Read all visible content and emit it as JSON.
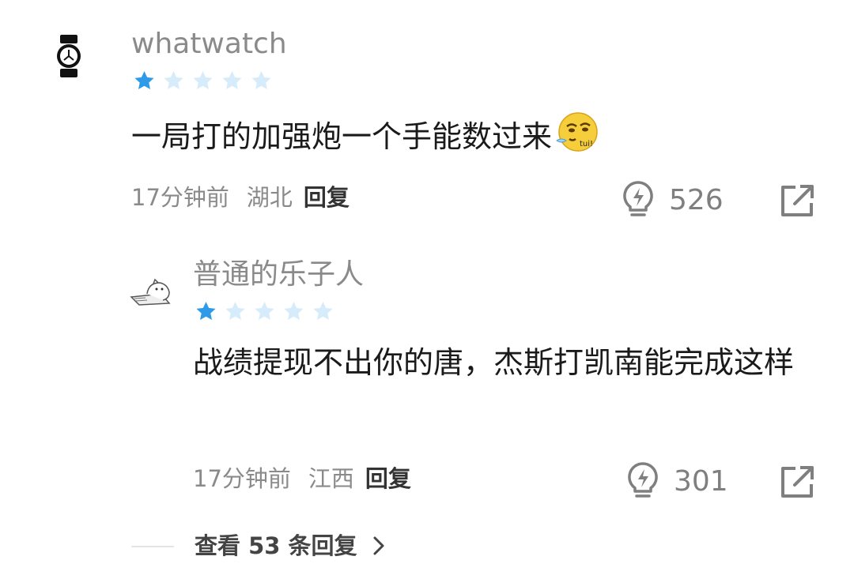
{
  "comments": [
    {
      "username": "whatwatch",
      "avatar_icon": "watch-icon",
      "rating": 1,
      "rating_max": 5,
      "text": "一局打的加强炮一个手能数过来",
      "emoji": "smug-emoji-tui",
      "emoji_text": "tui!",
      "time": "17分钟前",
      "location": "湖北",
      "reply_label": "回复",
      "likes": "526"
    },
    {
      "username": "普通的乐子人",
      "avatar_icon": "sketch-cat-avatar",
      "rating": 1,
      "rating_max": 5,
      "text": "战绩提现不出你的唐，杰斯打凯南能完成这样",
      "time": "17分钟前",
      "location": "江西",
      "reply_label": "回复",
      "likes": "301"
    }
  ],
  "view_more": {
    "label": "查看 53 条回复",
    "icon": "chevron-right-icon"
  },
  "colors": {
    "star_filled": "#2e9be8",
    "star_empty": "#d6ecfb",
    "muted_text": "#8a8a8a",
    "reply_text": "#333333"
  }
}
